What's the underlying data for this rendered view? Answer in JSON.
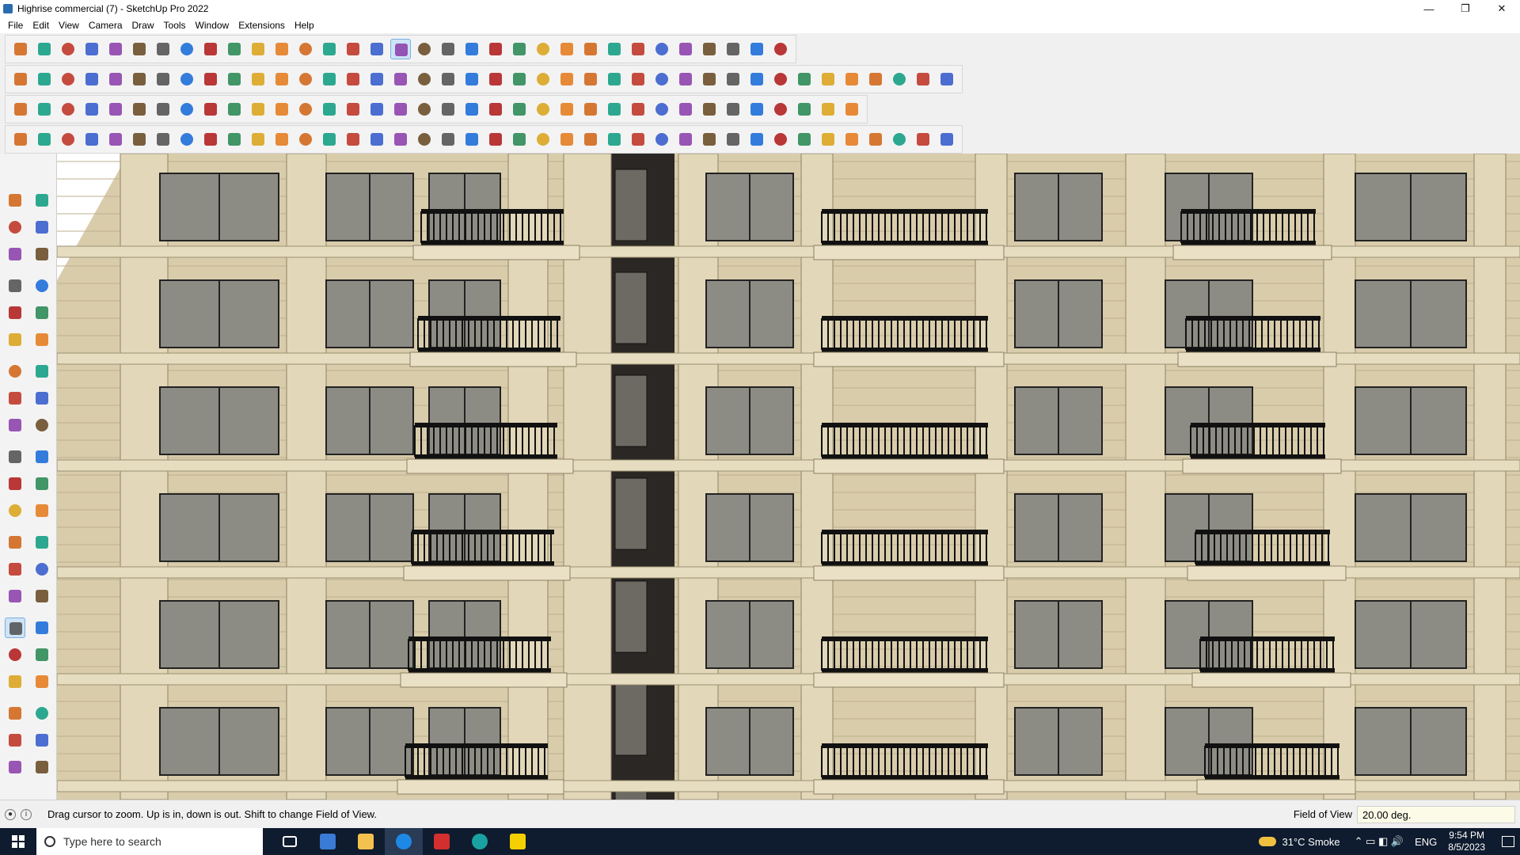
{
  "window": {
    "title": "Highrise commercial (7) - SketchUp Pro 2022",
    "controls": [
      "—",
      "❐",
      "✕"
    ]
  },
  "menu": [
    "File",
    "Edit",
    "View",
    "Camera",
    "Draw",
    "Tools",
    "Window",
    "Extensions",
    "Help"
  ],
  "toolbars": {
    "row1": [
      "zoom-icon",
      "select-icon",
      "eraser-icon",
      "line-icon",
      "arc-icon",
      "rectangle-icon",
      "push-pull-icon",
      "follow-me-icon",
      "move-icon",
      "rotate-icon",
      "scale-icon",
      "tape-measure-icon",
      "text-icon",
      "paint-bucket-icon",
      "orbit-icon",
      "pan-icon",
      "zoom-window-icon",
      "zoom-extents-icon",
      "section-plane-icon",
      "layers-icon",
      "styles-icon",
      "components-icon",
      "user-icon",
      "warehouse-icon",
      "share-icon",
      "ext-warehouse-icon",
      "upload-icon",
      "download-icon",
      "sandbox-icon",
      "solid-icon",
      "undo-icon",
      "redo-icon",
      "info-icon"
    ],
    "row2": [
      "iso-view-icon",
      "top-view-icon",
      "front-view-icon",
      "solid-tools-icon",
      "union-icon",
      "subtract-icon",
      "trim-icon",
      "intersect-icon",
      "split-icon",
      "outer-shell-icon",
      "curve-icon",
      "axis-icon",
      "section-icon",
      "section-fill-icon",
      "terrain-icon",
      "stamp-icon",
      "house-icon",
      "home-icon",
      "roof-icon",
      "window-icon",
      "door-icon",
      "dimension-icon",
      "tag-icon",
      "pencil-icon",
      "circle-icon",
      "polygon-icon",
      "ellipse-icon",
      "shape-icon",
      "freehand-icon",
      "bezier-icon",
      "spline-icon",
      "join-icon",
      "offset-icon",
      "weld-icon",
      "material-icon",
      "texture-icon",
      "stairs-icon",
      "wall-icon",
      "floor-icon",
      "render-icon"
    ],
    "row3": [
      "plane-icon",
      "face-icon",
      "cube-icon",
      "box-icon",
      "flatten-icon",
      "loop-icon",
      "extrude-icon",
      "wall-tool-icon",
      "frame-icon",
      "beam-icon",
      "pipe-icon",
      "corner-icon",
      "path-icon",
      "cross-icon",
      "align-icon",
      "connect-icon",
      "distribute-icon",
      "cone-icon",
      "warn-icon",
      "loop2-icon",
      "knot-icon",
      "twist-icon",
      "array-icon",
      "box3d-icon",
      "magnet-icon",
      "mirror-icon",
      "explode-icon",
      "copy-icon",
      "chip-icon",
      "gear-icon",
      "grid-icon",
      "lattice-icon",
      "net-icon",
      "close-grid-icon",
      "curve2-icon",
      "layout-icon"
    ],
    "row4": [
      "draw-icon",
      "bezier2-icon",
      "car-icon",
      "trim2-icon",
      "gear2-icon",
      "shape2-icon",
      "hand-icon",
      "sphere-icon",
      "smooth-icon",
      "twist2-icon",
      "fillet-icon",
      "chamfer-icon",
      "cut-icon",
      "slice-icon",
      "drape-icon",
      "sweep-icon",
      "bar-icon",
      "column-icon",
      "helix-icon",
      "mesh-icon",
      "skin-icon",
      "extrude2-icon",
      "stair-icon",
      "hatch-icon",
      "rake-icon",
      "scissors-icon",
      "bridge-icon",
      "edge-icon",
      "dome-icon",
      "shell-icon",
      "lattice2-icon",
      "pattern-icon",
      "fins-icon",
      "fan-icon",
      "comb-icon",
      "spring-icon",
      "bars-icon",
      "grille-icon",
      "loft-icon",
      "skew-icon"
    ]
  },
  "left_toolbar": [
    "select-icon",
    "orbit-pick-icon",
    "paint-icon",
    "eraser-icon",
    "component-icon",
    "tape-icon",
    "line-icon",
    "freehand-icon",
    "rectangle-icon",
    "rotated-rect-icon",
    "circle-icon",
    "polygon-icon",
    "arc-icon",
    "arc2-icon",
    "pie-icon",
    "arc3-icon",
    "move-icon",
    "push-pull-icon",
    "rotate-icon",
    "follow-me-icon",
    "scale-icon",
    "offset-icon",
    "tape-measure-icon",
    "dimension-icon",
    "protractor-icon",
    "text-icon",
    "axes-icon",
    "3d-text-icon",
    "orbit-icon",
    "pan-icon",
    "zoom-icon",
    "zoom-window-icon",
    "zoom-extents-icon",
    "previous-icon",
    "position-camera-icon",
    "look-around-icon",
    "walk-icon",
    "section-icon",
    "styles-icon",
    "layers-icon",
    "components-icon",
    "materials-icon"
  ],
  "statusbar": {
    "message": "Drag cursor to zoom.  Up is in, down is out. Shift to change Field of View.",
    "vcb_label": "Field of View",
    "vcb_value": "20.00 deg."
  },
  "taskbar": {
    "search_placeholder": "Type here to search",
    "weather": "31°C  Smoke",
    "lang": "ENG",
    "time": "9:54 PM",
    "date": "8/5/2023"
  },
  "colors": {
    "facade": "#d9ccab",
    "glass": "#8d8c84",
    "railing": "#111111",
    "accent": "#2b6cb0"
  }
}
